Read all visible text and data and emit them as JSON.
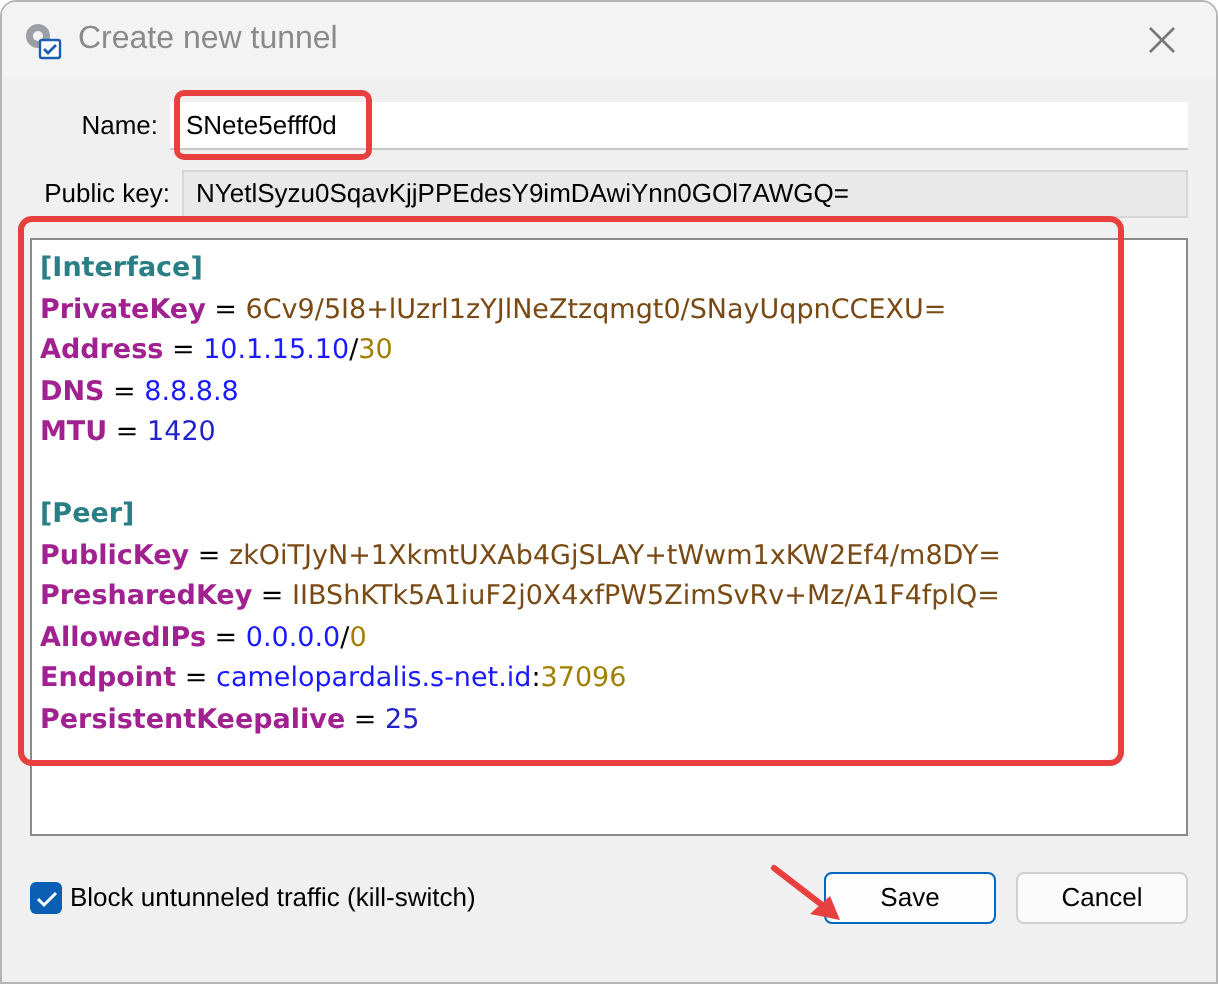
{
  "window": {
    "title": "Create new tunnel"
  },
  "name_field": {
    "label": "Name:",
    "value": "SNete5efff0d"
  },
  "public_key": {
    "label": "Public key:",
    "value": "NYetlSyzu0SqavKjjPPEdesY9imDAwiYnn0GOl7AWGQ="
  },
  "config": [
    {
      "header": "[Interface]",
      "lines": [
        [
          {
            "kind": "key",
            "text": "PrivateKey"
          },
          {
            "kind": "op",
            "text": " = "
          },
          {
            "kind": "base64",
            "text": "6Cv9/5I8+lUzrl1zYJlNeZtzqmgt0/SNayUqpnCCEXU="
          }
        ],
        [
          {
            "kind": "key",
            "text": "Address"
          },
          {
            "kind": "op",
            "text": " = "
          },
          {
            "kind": "ip",
            "text": "10.1.15.10"
          },
          {
            "kind": "op",
            "text": "/"
          },
          {
            "kind": "cidr",
            "text": "30"
          }
        ],
        [
          {
            "kind": "key",
            "text": "DNS"
          },
          {
            "kind": "op",
            "text": " = "
          },
          {
            "kind": "ip",
            "text": "8.8.8.8"
          }
        ],
        [
          {
            "kind": "key",
            "text": "MTU"
          },
          {
            "kind": "op",
            "text": " = "
          },
          {
            "kind": "number",
            "text": "1420"
          }
        ]
      ]
    },
    {
      "header": "[Peer]",
      "lines": [
        [
          {
            "kind": "key",
            "text": "PublicKey"
          },
          {
            "kind": "op",
            "text": " = "
          },
          {
            "kind": "base64",
            "text": "zkOiTJyN+1XkmtUXAb4GjSLAY+tWwm1xKW2Ef4/m8DY="
          }
        ],
        [
          {
            "kind": "key",
            "text": "PresharedKey"
          },
          {
            "kind": "op",
            "text": " = "
          },
          {
            "kind": "base64",
            "text": "IIBShKTk5A1iuF2j0X4xfPW5ZimSvRv+Mz/A1F4fplQ="
          }
        ],
        [
          {
            "kind": "key",
            "text": "AllowedIPs"
          },
          {
            "kind": "op",
            "text": " = "
          },
          {
            "kind": "ip",
            "text": "0.0.0.0"
          },
          {
            "kind": "op",
            "text": "/"
          },
          {
            "kind": "cidr",
            "text": "0"
          }
        ],
        [
          {
            "kind": "key",
            "text": "Endpoint"
          },
          {
            "kind": "op",
            "text": " = "
          },
          {
            "kind": "ip",
            "text": "camelopardalis.s-net.id"
          },
          {
            "kind": "op",
            "text": ":"
          },
          {
            "kind": "cidr",
            "text": "37096"
          }
        ],
        [
          {
            "kind": "key",
            "text": "PersistentKeepalive"
          },
          {
            "kind": "op",
            "text": " = "
          },
          {
            "kind": "number",
            "text": "25"
          }
        ]
      ]
    }
  ],
  "kill_switch": {
    "label": "Block untunneled traffic (kill-switch)",
    "checked": true
  },
  "buttons": [
    {
      "label": "Save",
      "selected": true
    },
    {
      "label": "Cancel",
      "selected": false
    }
  ]
}
